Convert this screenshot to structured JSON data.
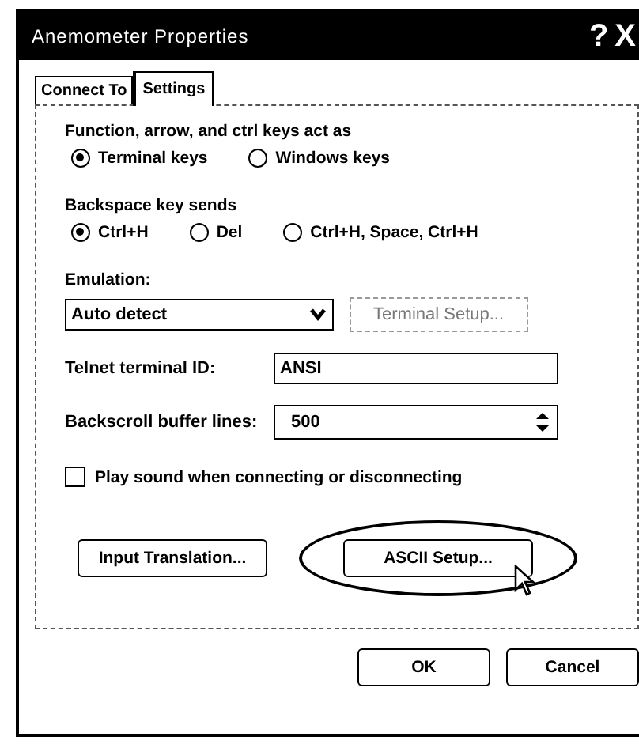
{
  "window": {
    "title": "Anemometer Properties",
    "title_buttons": [
      "?",
      "X"
    ]
  },
  "tabs": [
    {
      "label": "Connect To",
      "selected": false
    },
    {
      "label": "Settings",
      "selected": true
    }
  ],
  "keys_group": {
    "label": "Function, arrow, and ctrl keys act as",
    "options": [
      {
        "label": "Terminal keys",
        "selected": true
      },
      {
        "label": "Windows keys",
        "selected": false
      }
    ]
  },
  "backspace_group": {
    "label": "Backspace key sends",
    "options": [
      {
        "label": "Ctrl+H",
        "selected": true
      },
      {
        "label": "Del",
        "selected": false
      },
      {
        "label": "Ctrl+H, Space, Ctrl+H",
        "selected": false
      }
    ]
  },
  "emulation": {
    "label": "Emulation:",
    "value": "Auto detect",
    "setup_button": {
      "label": "Terminal Setup...",
      "disabled": true
    }
  },
  "telnet_id": {
    "label": "Telnet terminal ID:",
    "value": "ANSI"
  },
  "backscroll": {
    "label": "Backscroll buffer lines:",
    "value": "500"
  },
  "play_sound": {
    "label": "Play sound when connecting or disconnecting",
    "checked": false
  },
  "panel_buttons": [
    {
      "label": "Input Translation...",
      "highlighted": false
    },
    {
      "label": "ASCII Setup...",
      "highlighted": true
    }
  ],
  "buttons": [
    "OK",
    "Cancel"
  ]
}
